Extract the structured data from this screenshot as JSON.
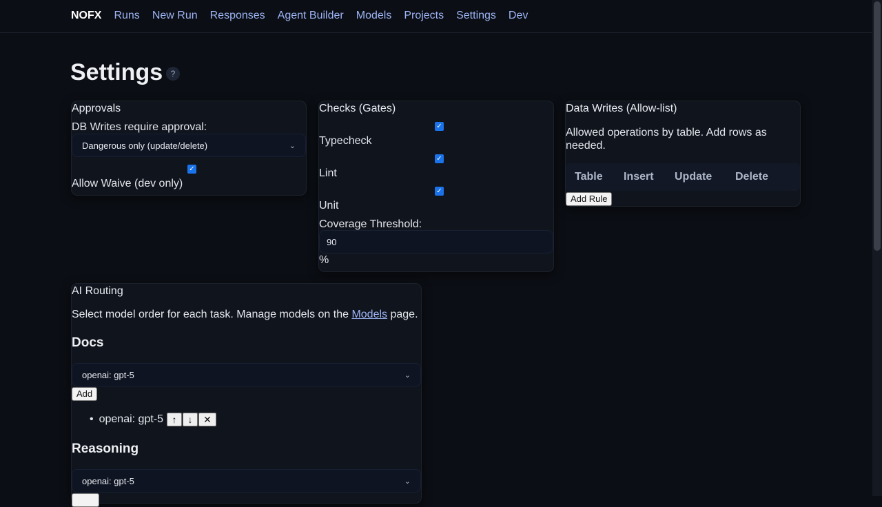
{
  "nav": {
    "brand": "NOFX",
    "links": [
      "Runs",
      "New Run",
      "Responses",
      "Agent Builder",
      "Models",
      "Projects",
      "Settings",
      "Dev"
    ]
  },
  "page": {
    "title": "Settings",
    "help": "?"
  },
  "approvals": {
    "title": "Approvals",
    "db_label": "DB Writes require approval:",
    "db_value": "Dangerous only (update/delete)",
    "waive_label": "Allow Waive (dev only)",
    "waive_checked": true
  },
  "checks": {
    "title": "Checks (Gates)",
    "items": [
      {
        "label": "Typecheck",
        "checked": true
      },
      {
        "label": "Lint",
        "checked": true
      },
      {
        "label": "Unit",
        "checked": true
      }
    ],
    "coverage_label": "Coverage Threshold:",
    "coverage_value": "90",
    "coverage_unit": "%"
  },
  "data_writes": {
    "title": "Data Writes (Allow-list)",
    "description": "Allowed operations by table. Add rows as needed.",
    "columns": [
      "Table",
      "Insert",
      "Update",
      "Delete"
    ],
    "add_rule": "Add Rule"
  },
  "ai_routing": {
    "title": "AI Routing",
    "desc_before": "Select model order for each task. Manage models on the ",
    "desc_link": "Models",
    "desc_after": " page.",
    "docs": {
      "heading": "Docs",
      "select_value": "openai: gpt-5",
      "add": "Add",
      "list": [
        "openai: gpt-5"
      ]
    },
    "reasoning": {
      "heading": "Reasoning",
      "select_value": "openai: gpt-5"
    },
    "item_buttons": {
      "up": "↑",
      "down": "↓",
      "remove": "✕"
    }
  }
}
